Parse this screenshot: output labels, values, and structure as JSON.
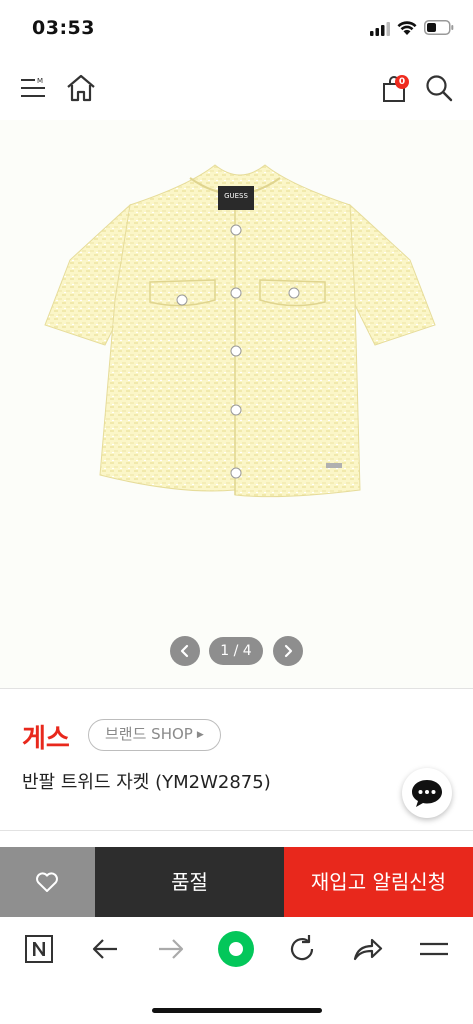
{
  "status_bar": {
    "time": "03:53"
  },
  "header": {
    "cart_count": "0",
    "icons": [
      "menu-icon",
      "home-icon",
      "shopping-bag-icon",
      "search-icon"
    ]
  },
  "gallery": {
    "counter": "1 / 4",
    "current_index": 1,
    "total": 4
  },
  "product": {
    "brand": "게스",
    "brand_shop_label": "브랜드 SHOP",
    "name": "반팔 트위드 자켓 (YM2W2875)",
    "jacket_label": "GUESS"
  },
  "actions": {
    "soldout_label": "품절",
    "restock_label": "재입고 알림신청"
  },
  "browser": {
    "icons": [
      "naver-icon",
      "back-arrow-icon",
      "forward-arrow-icon",
      "green-dot-home-icon",
      "reload-icon",
      "share-icon",
      "hamburger-menu-icon"
    ]
  },
  "colors": {
    "brand_red": "#e8281c",
    "dark_button": "#2d2d2d",
    "gray_button": "#8f8f8f",
    "naver_green": "#03c75a"
  }
}
